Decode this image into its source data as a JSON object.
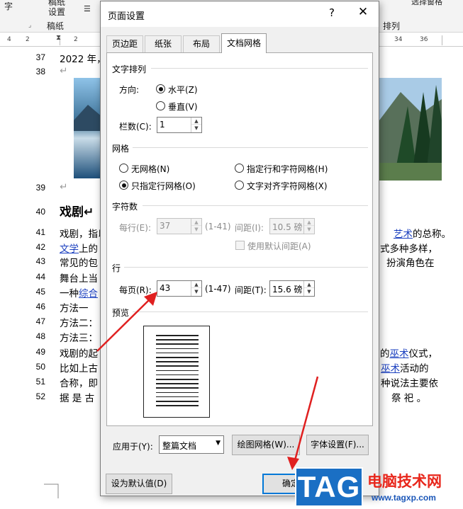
{
  "ribbon": {
    "font_frag": "字",
    "draft_settings_1": "稿纸",
    "draft_settings_2": "设置",
    "draft_group": "稿纸",
    "right_group": "排列",
    "right_top": "选择窗格"
  },
  "ruler": {
    "nums": [
      "4",
      "2",
      "2",
      "34",
      "36"
    ]
  },
  "document": {
    "lines": [
      {
        "n": "37",
        "text": "2022 年，"
      },
      {
        "n": "38",
        "text": "↵"
      },
      {
        "n": "39",
        "text": "↵"
      },
      {
        "n": "40",
        "text": "戏剧↵"
      },
      {
        "n": "41",
        "text": "戏剧，指以",
        "link": "艺术",
        "tail": "的总称。"
      },
      {
        "n": "42",
        "text": "",
        "link": "文学",
        "tail": "上的",
        "right": "式多种多样，"
      },
      {
        "n": "43",
        "text": "常见的包",
        "right": "扮演角色在"
      },
      {
        "n": "44",
        "text": "舞台上当"
      },
      {
        "n": "45",
        "text": "一种",
        "link": "综合"
      },
      {
        "n": "46",
        "text": "方法一"
      },
      {
        "n": "47",
        "text": "方法二："
      },
      {
        "n": "48",
        "text": "方法三："
      },
      {
        "n": "49",
        "text": "戏剧的起",
        "right_pre": "的",
        "right_link": "巫术",
        "right": "仪式，"
      },
      {
        "n": "50",
        "text": "比如上古",
        "right_link": "巫术",
        "right": "活动的"
      },
      {
        "n": "51",
        "text": "合称，即",
        "right": "种说法主要依"
      },
      {
        "n": "52",
        "text": "据 是 古",
        "right": "祭 祀 。"
      }
    ]
  },
  "dialog": {
    "title": "页面设置",
    "help": "?",
    "close": "✕",
    "tabs": [
      "页边距",
      "纸张",
      "布局",
      "文档网格"
    ],
    "text_direction": {
      "section": "文字排列",
      "direction_label": "方向:",
      "horizontal": "水平(Z)",
      "vertical": "垂直(V)",
      "columns_label": "栏数(C):",
      "columns_value": "1"
    },
    "grid": {
      "section": "网格",
      "none": "无网格(N)",
      "line_and_char": "指定行和字符网格(H)",
      "line_only": "只指定行网格(O)",
      "snap_char": "文字对齐字符网格(X)"
    },
    "chars": {
      "section": "字符数",
      "per_line_label": "每行(E):",
      "per_line_value": "37",
      "per_line_range": "(1-41)",
      "pitch_label": "间距(I):",
      "pitch_value": "10.5 磅",
      "default_pitch": "使用默认间距(A)"
    },
    "lines": {
      "section": "行",
      "per_page_label": "每页(R):",
      "per_page_value": "43",
      "per_page_range": "(1-47)",
      "pitch_label": "间距(T):",
      "pitch_value": "15.6 磅"
    },
    "preview": {
      "section": "预览",
      "line_count": 17
    },
    "apply_label": "应用于(Y):",
    "apply_value": "整篇文档",
    "draw_grid": "绘图网格(W)...",
    "font_settings": "字体设置(F)...",
    "set_default": "设为默认值(D)",
    "ok": "确定"
  },
  "watermark": {
    "logo": "TAG",
    "name": "电脑技术网",
    "url": "www.tagxp.com"
  },
  "colors": {
    "annotation_arrow": "#e02020",
    "link": "#1a3fbf",
    "focus": "#0078d7",
    "watermark_blue": "#1a6fc4",
    "watermark_red": "#e8261b"
  }
}
